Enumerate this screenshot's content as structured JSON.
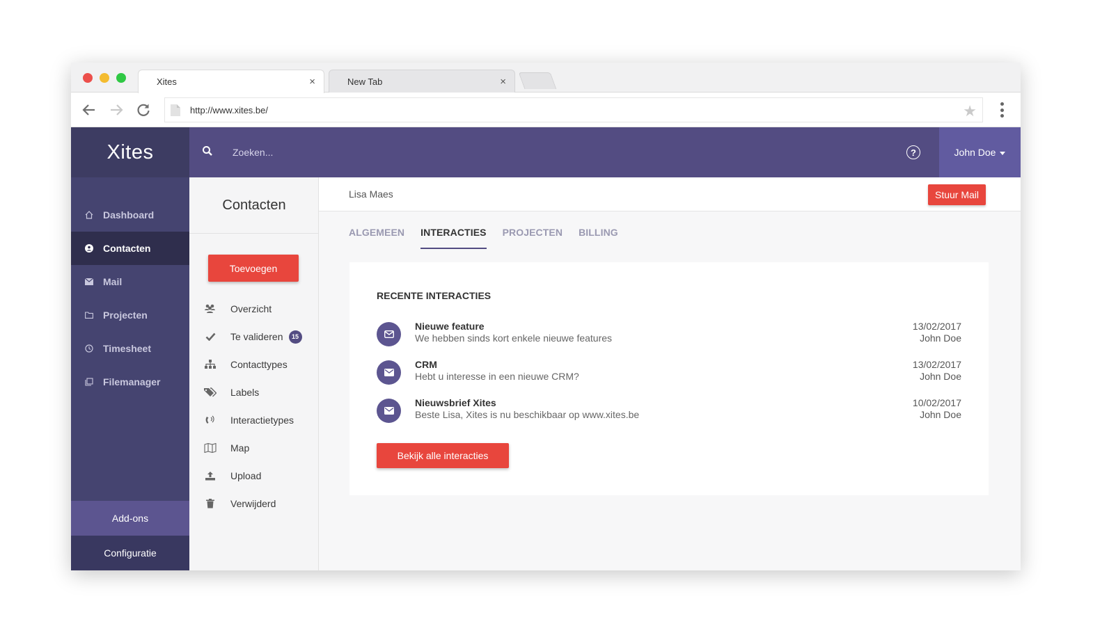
{
  "browser": {
    "tabs": [
      {
        "title": "Xites"
      },
      {
        "title": "New Tab"
      }
    ],
    "tab_close_glyph": "×",
    "url": "http://www.xites.be/"
  },
  "app": {
    "brand": "Xites",
    "search_placeholder": "Zoeken...",
    "user_name": "John Doe",
    "colors": {
      "primary": "#534c82",
      "sidebar": "#454470",
      "accent": "#e8463d"
    }
  },
  "sidebar": {
    "items": [
      {
        "label": "Dashboard",
        "icon": "home-icon"
      },
      {
        "label": "Contacten",
        "icon": "user-icon",
        "active": true
      },
      {
        "label": "Mail",
        "icon": "envelope-icon"
      },
      {
        "label": "Projecten",
        "icon": "folder-icon"
      },
      {
        "label": "Timesheet",
        "icon": "clock-icon"
      },
      {
        "label": "Filemanager",
        "icon": "files-icon"
      }
    ],
    "addons": "Add-ons",
    "config": "Configuratie"
  },
  "subpanel": {
    "title": "Contacten",
    "add_button": "Toevoegen",
    "items": [
      {
        "label": "Overzicht",
        "icon": "users-icon"
      },
      {
        "label": "Te valideren",
        "icon": "check-icon",
        "badge": "15"
      },
      {
        "label": "Contacttypes",
        "icon": "sitemap-icon"
      },
      {
        "label": "Labels",
        "icon": "tags-icon"
      },
      {
        "label": "Interactietypes",
        "icon": "phone-volume-icon"
      },
      {
        "label": "Map",
        "icon": "map-icon"
      },
      {
        "label": "Upload",
        "icon": "upload-icon"
      },
      {
        "label": "Verwijderd",
        "icon": "trash-icon"
      }
    ]
  },
  "main": {
    "breadcrumb": "Lisa Maes",
    "mail_button": "Stuur Mail",
    "tabs": [
      "ALGEMEEN",
      "INTERACTIES",
      "PROJECTEN",
      "BILLING"
    ],
    "active_tab": "INTERACTIES",
    "card": {
      "title": "RECENTE INTERACTIES",
      "interactions": [
        {
          "title": "Nieuwe feature",
          "text": "We hebben sinds kort enkele nieuwe features",
          "date": "13/02/2017",
          "user": "John Doe"
        },
        {
          "title": "CRM",
          "text": "Hebt u interesse in een nieuwe CRM?",
          "date": "13/02/2017",
          "user": "John Doe"
        },
        {
          "title": "Nieuwsbrief Xites",
          "text": "Beste Lisa, Xites is nu beschikbaar op www.xites.be",
          "date": "10/02/2017",
          "user": "John Doe"
        }
      ],
      "all_button": "Bekijk alle interacties"
    }
  }
}
